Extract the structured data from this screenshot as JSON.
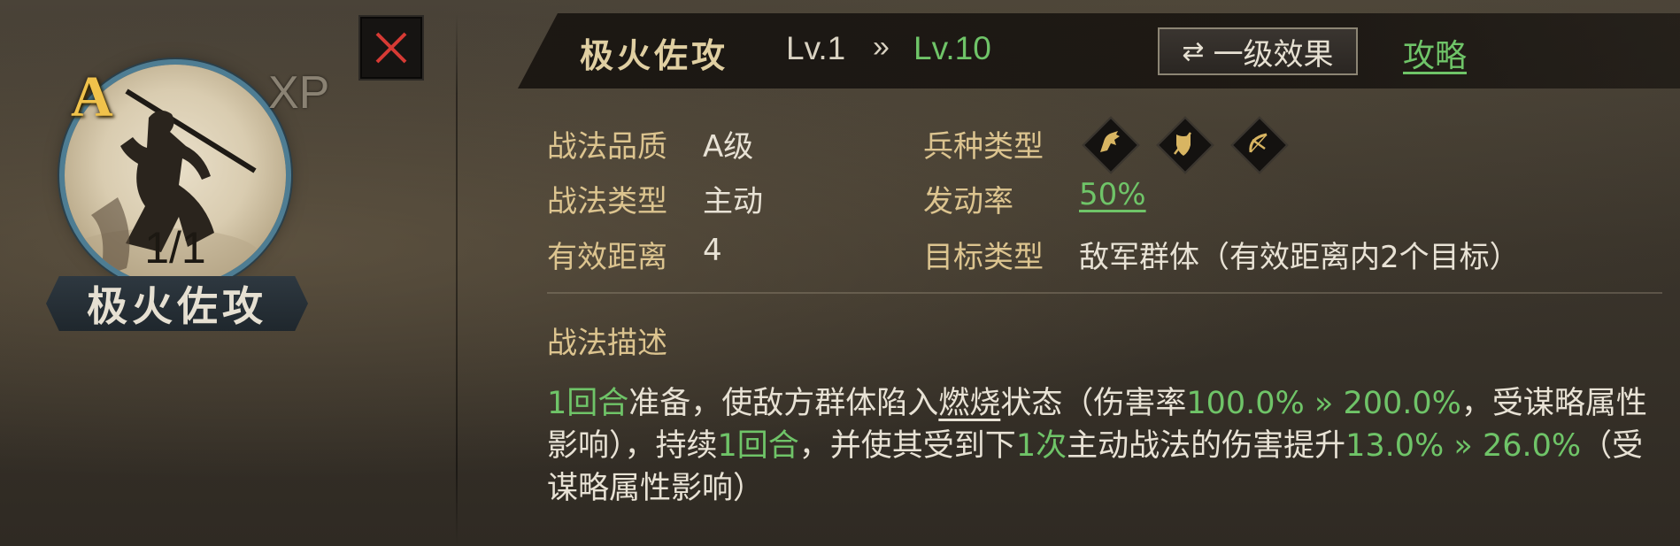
{
  "skill_card": {
    "grade": "A",
    "xp_label": "XP",
    "count": "1/1",
    "name": "极火佐攻"
  },
  "header": {
    "title": "极火佐攻",
    "level_from": "Lv.1",
    "arrow": "»",
    "level_to": "Lv.10",
    "level_effect_icon": "⇄",
    "level_effect_label": "一级效果",
    "guide_label": "攻略"
  },
  "attributes": {
    "quality_label": "战法品质",
    "quality_value": "A级",
    "type_label": "战法类型",
    "type_value": "主动",
    "range_label": "有效距离",
    "range_value": "4",
    "troop_label": "兵种类型",
    "troop_icons": [
      "cavalry-icon",
      "shield-icon",
      "bow-icon"
    ],
    "rate_label": "发动率",
    "rate_value": "50%",
    "target_label": "目标类型",
    "target_value": "敌军群体（有效距离内2个目标）"
  },
  "description": {
    "title": "战法描述",
    "p1": "1回合",
    "p2": "准备，使敌方群体陷入",
    "p3": "燃烧",
    "p4": "状态（伤害率",
    "p5": "100.0% » 200.0%",
    "p6": "，受谋略属性影响），持续",
    "p7": "1回合",
    "p8": "，并使其受到下",
    "p9": "1次",
    "p10": "主动战法的伤害提升",
    "p11": "13.0% » 26.0%",
    "p12": "（受谋略属性影响）"
  },
  "colors": {
    "accent_green": "#6fc468",
    "label_gold": "#dcc48f",
    "grade_gold": "#f0c24b",
    "close_red": "#d63a34"
  }
}
